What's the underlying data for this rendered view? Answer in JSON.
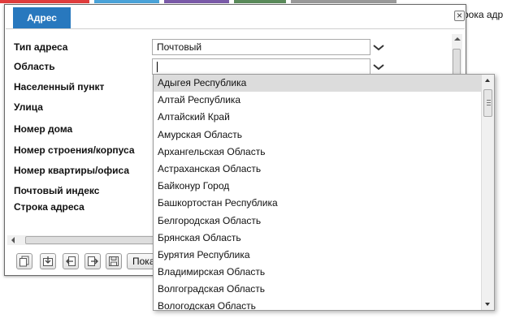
{
  "background": {
    "partial_text": "рока адр"
  },
  "colors": {
    "tab_bg": "#2878be",
    "selected_item_bg": "#dcdcdc"
  },
  "dialog": {
    "tab_label": "Адрес",
    "close_label": "×",
    "fields": [
      {
        "label": "Тип адреса",
        "value": "Почтовый"
      },
      {
        "label": "Область",
        "value": ""
      },
      {
        "label": "Населенный пункт"
      },
      {
        "label": "Улица"
      },
      {
        "label": "Номер дома"
      },
      {
        "label": "Номер строения/корпуса"
      },
      {
        "label": "Номер квартиры/офиса"
      },
      {
        "label": "Почтовый индекс"
      },
      {
        "label": "Строка адреса"
      }
    ],
    "toolbar": {
      "icons": [
        "copy-icon",
        "import-icon",
        "import-left-icon",
        "export-icon",
        "save-icon"
      ],
      "show_button_label": "Показ"
    }
  },
  "dropdown": {
    "selected_index": 0,
    "items": [
      "Адыгея Республика",
      "Алтай Республика",
      "Алтайский Край",
      "Амурская Область",
      "Архангельская Область",
      "Астраханская Область",
      "Байконур Город",
      "Башкортостан Республика",
      "Белгородская Область",
      "Брянская Область",
      "Бурятия Республика",
      "Владимирская Область",
      "Волгоградская Область",
      "Вологодская Область"
    ]
  }
}
